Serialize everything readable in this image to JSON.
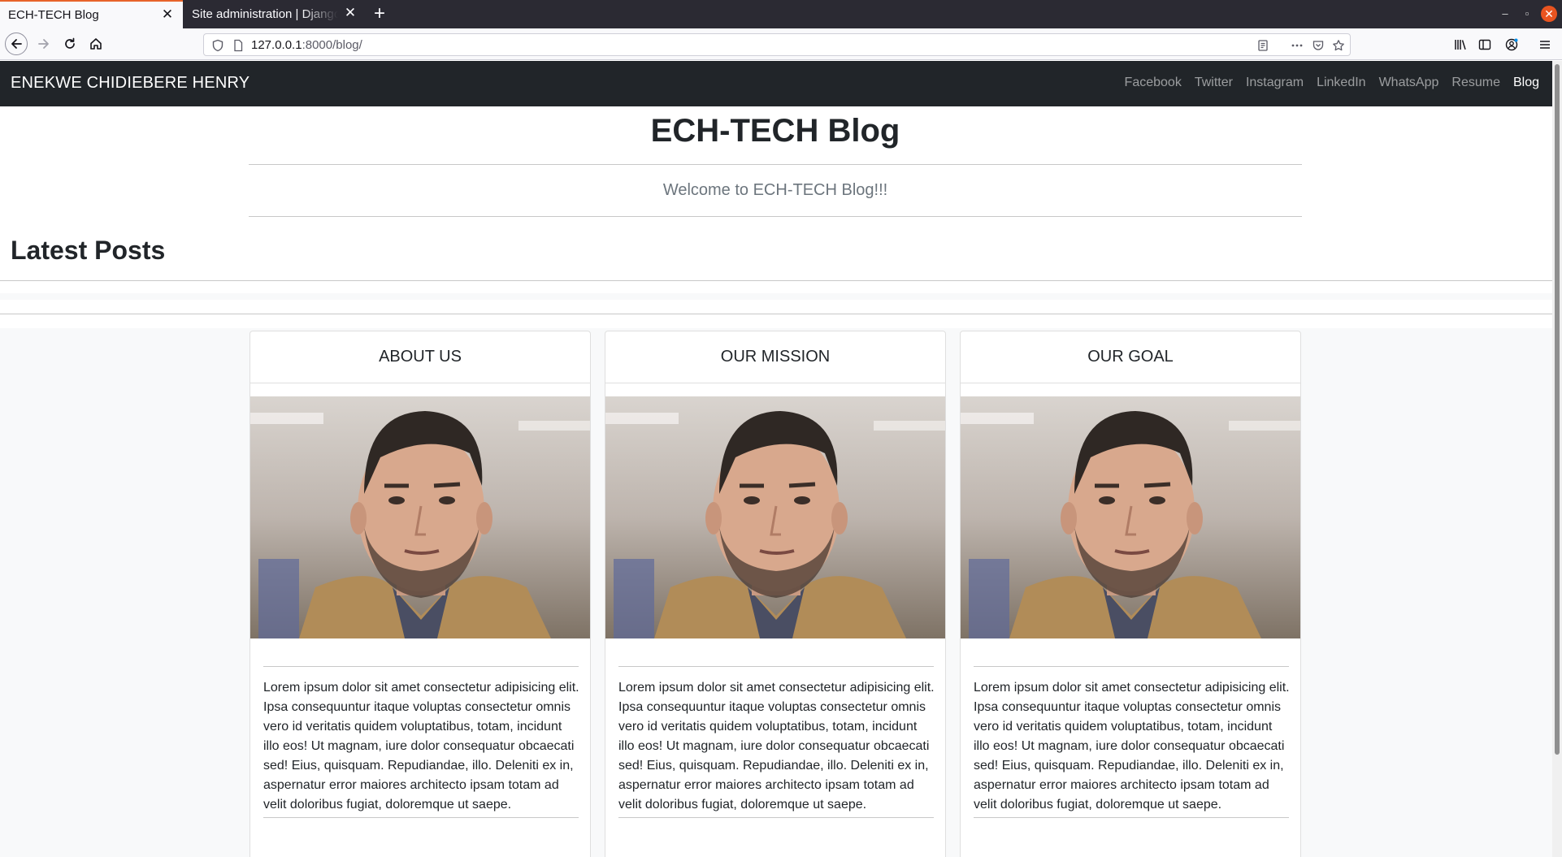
{
  "browser": {
    "tabs": [
      {
        "label": "ECH-TECH Blog",
        "active": true
      },
      {
        "label": "Site administration | Django site admin",
        "active": false
      }
    ],
    "url_host": "127.0.0.1",
    "url_rest": ":8000/blog/",
    "window_controls": {
      "minimize": "–",
      "restore": "▫",
      "close": "✕"
    }
  },
  "site": {
    "brand": "ENEKWE CHIDIEBERE HENRY",
    "nav_links": [
      {
        "label": "Facebook"
      },
      {
        "label": "Twitter"
      },
      {
        "label": "Instagram"
      },
      {
        "label": "LinkedIn"
      },
      {
        "label": "WhatsApp"
      },
      {
        "label": "Resume"
      },
      {
        "label": "Blog",
        "active": true
      }
    ]
  },
  "main": {
    "title": "ECH-TECH Blog",
    "welcome": "Welcome to ECH-TECH Blog!!!",
    "section_heading": "Latest Posts"
  },
  "cards": [
    {
      "title": "ABOUT US",
      "image": "portrait-photo",
      "body": "Lorem ipsum dolor sit amet consectetur adipisicing elit. Ipsa consequuntur itaque voluptas consectetur omnis vero id veritatis quidem voluptatibus, totam, incidunt illo eos! Ut magnam, iure dolor consequatur obcaecati sed! Eius, quisquam. Repudiandae, illo. Deleniti ex in, aspernatur error maiores architecto ipsam totam ad velit doloribus fugiat, doloremque ut saepe."
    },
    {
      "title": "OUR MISSION",
      "image": "portrait-photo",
      "body": "Lorem ipsum dolor sit amet consectetur adipisicing elit. Ipsa consequuntur itaque voluptas consectetur omnis vero id veritatis quidem voluptatibus, totam, incidunt illo eos! Ut magnam, iure dolor consequatur obcaecati sed! Eius, quisquam. Repudiandae, illo. Deleniti ex in, aspernatur error maiores architecto ipsam totam ad velit doloribus fugiat, doloremque ut saepe."
    },
    {
      "title": "OUR GOAL",
      "image": "portrait-photo",
      "body": "Lorem ipsum dolor sit amet consectetur adipisicing elit. Ipsa consequuntur itaque voluptas consectetur omnis vero id veritatis quidem voluptatibus, totam, incidunt illo eos! Ut magnam, iure dolor consequatur obcaecati sed! Eius, quisquam. Repudiandae, illo. Deleniti ex in, aspernatur error maiores architecto ipsam totam ad velit doloribus fugiat, doloremque ut saepe."
    }
  ],
  "colors": {
    "navbar_bg": "#212529",
    "tab_accent": "#e8632a",
    "window_close": "#e95420",
    "muted_text": "#6c757d"
  }
}
